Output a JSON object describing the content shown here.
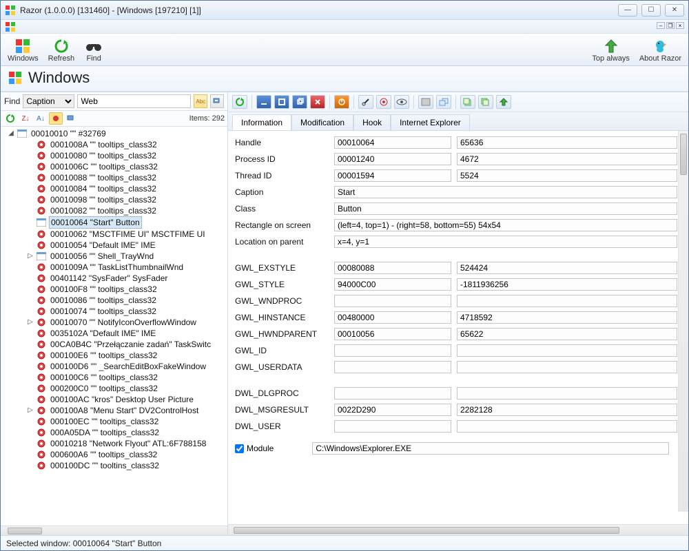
{
  "title": "Razor (1.0.0.0) [131460] - [Windows [197210] [1]]",
  "ribbon": {
    "windows": "Windows",
    "refresh": "Refresh",
    "find": "Find",
    "top_always": "Top always",
    "about": "About Razor"
  },
  "section_header": "Windows",
  "find": {
    "label": "Find",
    "mode": "Caption",
    "text": "Web"
  },
  "items_count": "Items: 292",
  "tree_root": {
    "id": "00010010",
    "label": "00010010 \"\" #32769"
  },
  "tree_nodes": [
    {
      "id": "0001008A",
      "text": "0001008A \"\" tooltips_class32",
      "icon": "gear"
    },
    {
      "id": "00010080",
      "text": "00010080 \"\" tooltips_class32",
      "icon": "gear"
    },
    {
      "id": "0001006C",
      "text": "0001006C \"\" tooltips_class32",
      "icon": "gear"
    },
    {
      "id": "00010088",
      "text": "00010088 \"\" tooltips_class32",
      "icon": "gear"
    },
    {
      "id": "00010084",
      "text": "00010084 \"\" tooltips_class32",
      "icon": "gear"
    },
    {
      "id": "00010098",
      "text": "00010098 \"\" tooltips_class32",
      "icon": "gear"
    },
    {
      "id": "00010082",
      "text": "00010082 \"\" tooltips_class32",
      "icon": "gear"
    },
    {
      "id": "00010064",
      "text": "00010064 \"Start\" Button",
      "icon": "win",
      "selected": true
    },
    {
      "id": "00010062",
      "text": "00010062 \"MSCTFIME UI\" MSCTFIME UI",
      "icon": "gear"
    },
    {
      "id": "00010054",
      "text": "00010054 \"Default IME\" IME",
      "icon": "gear"
    },
    {
      "id": "00010056",
      "text": "00010056 \"\" Shell_TrayWnd",
      "icon": "win",
      "exp": "▷"
    },
    {
      "id": "0001009A",
      "text": "0001009A \"\" TaskListThumbnailWnd",
      "icon": "gear"
    },
    {
      "id": "00401142",
      "text": "00401142 \"SysFader\" SysFader",
      "icon": "gear"
    },
    {
      "id": "000100F8",
      "text": "000100F8 \"\" tooltips_class32",
      "icon": "gear"
    },
    {
      "id": "00010086",
      "text": "00010086 \"\" tooltips_class32",
      "icon": "gear"
    },
    {
      "id": "00010074",
      "text": "00010074 \"\" tooltips_class32",
      "icon": "gear"
    },
    {
      "id": "00010070",
      "text": "00010070 \"\" NotifyIconOverflowWindow",
      "icon": "gear",
      "exp": "▷"
    },
    {
      "id": "0035102A",
      "text": "0035102A \"Default IME\" IME",
      "icon": "gear"
    },
    {
      "id": "00CA0B4C",
      "text": "00CA0B4C \"Przełączanie zadań\" TaskSwitc",
      "icon": "gear"
    },
    {
      "id": "000100E6",
      "text": "000100E6 \"\" tooltips_class32",
      "icon": "gear"
    },
    {
      "id": "000100D6",
      "text": "000100D6 \"\" _SearchEditBoxFakeWindow",
      "icon": "gear"
    },
    {
      "id": "000100C6",
      "text": "000100C6 \"\" tooltips_class32",
      "icon": "gear"
    },
    {
      "id": "000200C0",
      "text": "000200C0 \"\" tooltips_class32",
      "icon": "gear"
    },
    {
      "id": "000100AC",
      "text": "000100AC \"kros\" Desktop User Picture",
      "icon": "gear"
    },
    {
      "id": "000100A8",
      "text": "000100A8 \"Menu Start\" DV2ControlHost",
      "icon": "gear",
      "exp": "▷"
    },
    {
      "id": "000100EC",
      "text": "000100EC \"\" tooltips_class32",
      "icon": "gear"
    },
    {
      "id": "000A05DA",
      "text": "000A05DA \"\" tooltips_class32",
      "icon": "gear"
    },
    {
      "id": "00010218",
      "text": "00010218 \"Network Flyout\" ATL:6F788158",
      "icon": "gear"
    },
    {
      "id": "000600A6",
      "text": "000600A6 \"\" tooltips_class32",
      "icon": "gear"
    },
    {
      "id": "000100DC",
      "text": "000100DC \"\" tooltins_class32",
      "icon": "gear"
    }
  ],
  "tabs": {
    "information": "Information",
    "modification": "Modification",
    "hook": "Hook",
    "ie": "Internet Explorer"
  },
  "info": {
    "handle_l": "Handle",
    "handle_hex": "00010064",
    "handle_dec": "65636",
    "pid_l": "Process ID",
    "pid_hex": "00001240",
    "pid_dec": "4672",
    "tid_l": "Thread ID",
    "tid_hex": "00001594",
    "tid_dec": "5524",
    "caption_l": "Caption",
    "caption": "Start",
    "class_l": "Class",
    "class": "Button",
    "rect_l": "Rectangle on screen",
    "rect": "(left=4, top=1) - (right=58, bottom=55) 54x54",
    "loc_l": "Location on parent",
    "loc": "x=4, y=1",
    "exstyle_l": "GWL_EXSTYLE",
    "exstyle_hex": "00080088",
    "exstyle_dec": "524424",
    "style_l": "GWL_STYLE",
    "style_hex": "94000C00",
    "style_dec": "-1811936256",
    "wndproc_l": "GWL_WNDPROC",
    "wndproc_hex": "",
    "wndproc_dec": "",
    "hinst_l": "GWL_HINSTANCE",
    "hinst_hex": "00480000",
    "hinst_dec": "4718592",
    "hwndpar_l": "GWL_HWNDPARENT",
    "hwndpar_hex": "00010056",
    "hwndpar_dec": "65622",
    "id_l": "GWL_ID",
    "id_hex": "",
    "id_dec": "",
    "ud_l": "GWL_USERDATA",
    "ud_hex": "",
    "ud_dec": "",
    "dlg_l": "DWL_DLGPROC",
    "dlg_hex": "",
    "dlg_dec": "",
    "msg_l": "DWL_MSGRESULT",
    "msg_hex": "0022D290",
    "msg_dec": "2282128",
    "user_l": "DWL_USER",
    "user_hex": "",
    "user_dec": "",
    "module_l": "Module",
    "module": "C:\\Windows\\Explorer.EXE"
  },
  "status": "Selected window: 00010064 \"Start\" Button"
}
